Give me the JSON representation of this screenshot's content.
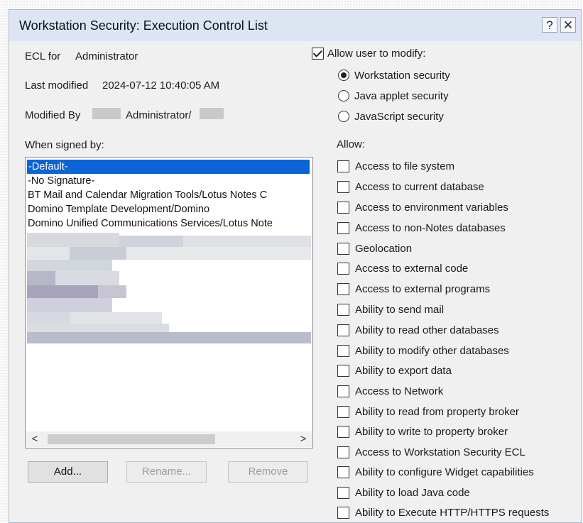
{
  "dialog": {
    "title": "Workstation Security: Execution Control List",
    "help_label": "?",
    "close_label": "✕"
  },
  "ecl_for": {
    "label": "ECL for",
    "value": "Administrator"
  },
  "last_modified": {
    "label": "Last modified",
    "value": "2024-07-12 10:40:05 AM"
  },
  "modified_by": {
    "label": "Modified By",
    "value": "Administrator/"
  },
  "when_signed_by": {
    "label": "When signed by:",
    "items": [
      "-Default-",
      "-No Signature-",
      "BT Mail and Calendar Migration Tools/Lotus Notes C",
      "Domino Template Development/Domino",
      "Domino Unified Communications Services/Lotus Note"
    ],
    "selected_index": 0
  },
  "scroll": {
    "left_label": "<",
    "right_label": ">"
  },
  "buttons": {
    "add": "Add...",
    "rename": "Rename...",
    "remove": "Remove"
  },
  "allow_user_to_modify": {
    "label": "Allow user to modify:",
    "checked": true,
    "options": [
      "Workstation security",
      "Java applet security",
      "JavaScript security"
    ],
    "selected_option": 0
  },
  "allow": {
    "label": "Allow:",
    "items": [
      "Access to file system",
      "Access to current database",
      "Access to environment variables",
      "Access to non-Notes databases",
      "Geolocation",
      "Access to external code",
      "Access to external programs",
      "Ability to send mail",
      "Ability to read other databases",
      "Ability to modify other databases",
      "Ability to export data",
      "Access to Network",
      "Ability to read from property broker",
      "Ability to write to property broker",
      "Access to Workstation Security ECL",
      "Ability to configure Widget capabilities",
      "Ability to load Java code",
      "Ability to Execute HTTP/HTTPS requests"
    ]
  },
  "colors": {
    "selection": "#0a64d6",
    "titlebar": "#dbe6f2",
    "dialog_bg": "#f0f0f0"
  }
}
